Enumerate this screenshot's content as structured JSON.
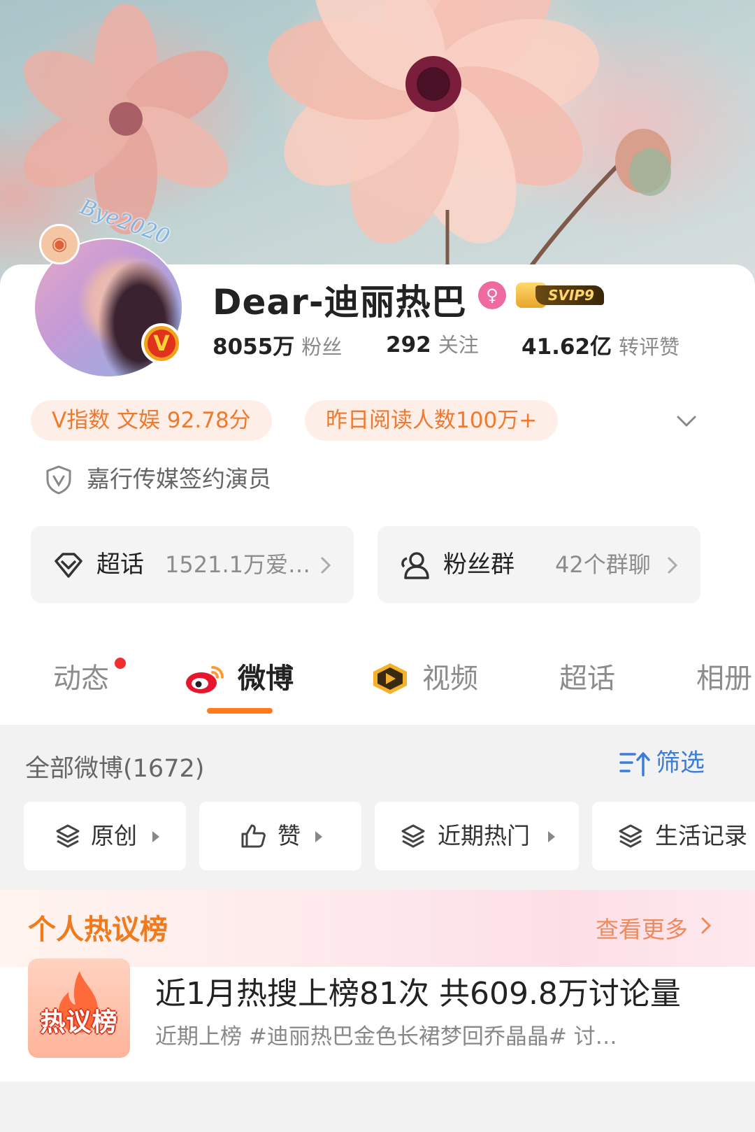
{
  "profile": {
    "name": "Dear-迪丽热巴",
    "avatar_deco_text": "Bye2020",
    "vip_label": "SVIP9",
    "stats": [
      {
        "num": "8055万",
        "label": "粉丝"
      },
      {
        "num": "292",
        "label": "关注"
      },
      {
        "num": "41.62亿",
        "label": "转评赞"
      }
    ],
    "tags": [
      "V指数 文娱 92.78分",
      "昨日阅读人数100万+"
    ],
    "signed": "嘉行传媒签约演员"
  },
  "entries": [
    {
      "title": "超话",
      "sub": "1521.1万爱…"
    },
    {
      "title": "粉丝群",
      "sub": "42个群聊"
    }
  ],
  "tabs": [
    "动态",
    "微博",
    "视频",
    "超话",
    "相册"
  ],
  "active_tab": "微博",
  "feed": {
    "all_count": "全部微博(1672)",
    "filter": "筛选",
    "chips": [
      "原创",
      "赞",
      "近期热门",
      "生活记录"
    ]
  },
  "hot": {
    "title": "个人热议榜",
    "more": "查看更多",
    "logo_text": "热议榜",
    "main": "近1月热搜上榜81次 共609.8万讨论量",
    "sub": "近期上榜 #迪丽热巴金色长裙梦回乔晶晶# 讨…"
  },
  "colors": {
    "accent": "#ff7a1a",
    "tag_bg": "#fdefe8",
    "tag_text": "#ef7a2f",
    "link_blue": "#3b7dd8",
    "hot_title": "#f07a1c"
  }
}
